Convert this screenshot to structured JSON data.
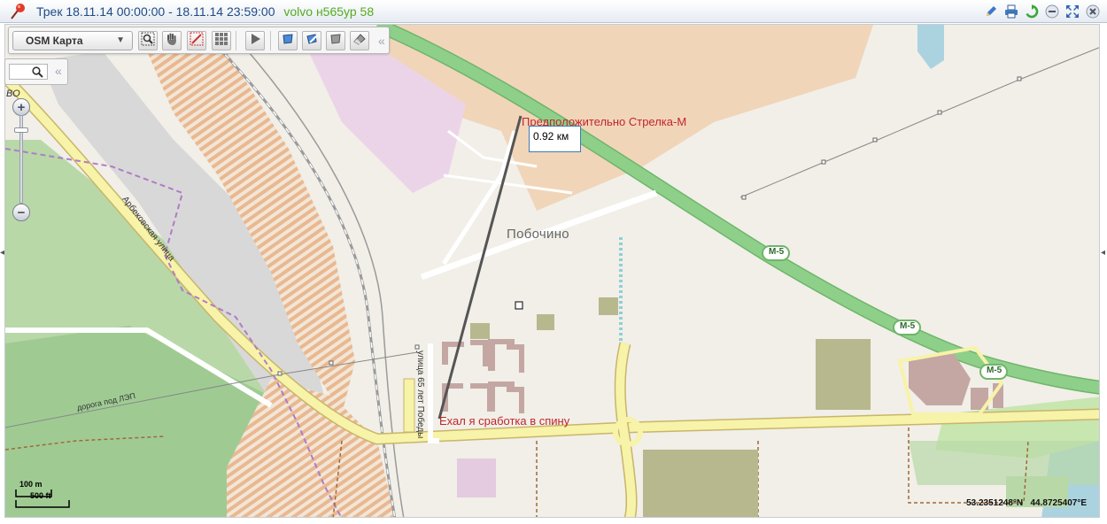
{
  "window": {
    "title": "Трек 18.11.14 00:00:00 - 18.11.14 23:59:00",
    "vehicle": "volvo н565ур 58"
  },
  "toolbar": {
    "layer_select": "OSM Карта"
  },
  "map": {
    "place_village": "Побочино",
    "street_arbekovskaya": "Арбековская улица",
    "street_65let": "улица 65 лет Победы",
    "road_lep": "дорога под ЛЭП",
    "highway_label": "М-5",
    "edge_fragment": "ВО",
    "annotation_top": "Предположительно Стрелка-М",
    "annotation_bottom": "Ехал я сработка в спину",
    "distance": "0.92 км",
    "scale_metric": "100 m",
    "scale_imperial": "500 ft",
    "latitude": "53.2351248°N",
    "longitude": "44.8725407°E"
  },
  "colors": {
    "title_text": "#1f4a86",
    "vehicle_text": "#55aa22",
    "highway_green": "#8ed08a",
    "annotation_red": "#c0262c",
    "track_line": "#555555"
  }
}
